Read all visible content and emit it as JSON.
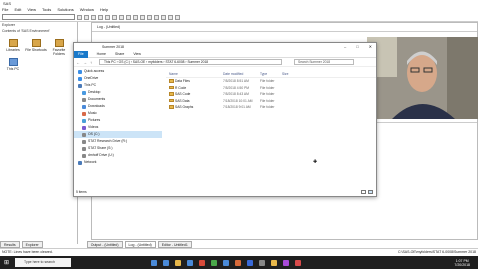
{
  "app": {
    "title": "SAS",
    "menus": [
      "File",
      "Edit",
      "View",
      "Tools",
      "Solutions",
      "Window",
      "Help"
    ]
  },
  "explorer": {
    "label": "Explorer",
    "subtitle": "Contents of 'SAS Environment'",
    "icons": [
      "Libraries",
      "File Shortcuts",
      "Favorite Folders",
      "This PC"
    ]
  },
  "log": {
    "title": "Log - (Untitled)"
  },
  "editor": {
    "title": "Editor - Untitled1"
  },
  "tabs": {
    "left": [
      "Results",
      "Explorer"
    ],
    "windows": [
      "Output - (Untitled)",
      "Log - (Untitled)",
      "Editor - Untitled1"
    ]
  },
  "status": {
    "left": "NOTE: Lines have been cleared.",
    "right": "C:\\SAS-OE\\myfolders\\STAT 6-0008\\Summer 2018"
  },
  "taskbar": {
    "search_placeholder": "Type here to search",
    "time": "1:07 PM",
    "date": "7/20/2018"
  },
  "file_explorer": {
    "title": "Summer 2018",
    "ribbon": [
      "File",
      "Home",
      "Share",
      "View"
    ],
    "address": [
      "This PC",
      "OS (C:)",
      "SAS-OE",
      "myfolders",
      "STAT 6-6008",
      "Summer 2018"
    ],
    "search_placeholder": "Search Summer 2018",
    "nav": [
      {
        "label": "Quick access",
        "color": "#3a8ee6"
      },
      {
        "label": "OneDrive",
        "color": "#3a8ee6"
      },
      {
        "label": "This PC",
        "color": "#4a7ab8"
      },
      {
        "label": "Desktop",
        "color": "#4a9ae0"
      },
      {
        "label": "Documents",
        "color": "#888"
      },
      {
        "label": "Downloads",
        "color": "#4a8ad8"
      },
      {
        "label": "Music",
        "color": "#d86a4a"
      },
      {
        "label": "Pictures",
        "color": "#4aa0d8"
      },
      {
        "label": "Videos",
        "color": "#7a5ad0"
      },
      {
        "label": "OS (C:)",
        "color": "#888"
      },
      {
        "label": "STAT Research Drive (R:)",
        "color": "#888"
      },
      {
        "label": "STAT Share (S:)",
        "color": "#888"
      },
      {
        "label": "dmhoff Drive (U:)",
        "color": "#888"
      },
      {
        "label": "Network",
        "color": "#4a7ab8"
      }
    ],
    "columns": [
      "Name",
      "Date modified",
      "Type",
      "Size"
    ],
    "files": [
      {
        "name": "Data Files",
        "date": "7/5/2018 8:51 AM",
        "type": "File folder"
      },
      {
        "name": "R Code",
        "date": "7/5/2018 4:50 PM",
        "type": "File folder"
      },
      {
        "name": "SAS Code",
        "date": "7/5/2018 8:43 AM",
        "type": "File folder"
      },
      {
        "name": "SAS Data",
        "date": "7/18/2018 10:01 AM",
        "type": "File folder"
      },
      {
        "name": "SAS Graphs",
        "date": "7/18/2018 9:01 AM",
        "type": "File folder"
      }
    ],
    "item_count": "5 items"
  }
}
